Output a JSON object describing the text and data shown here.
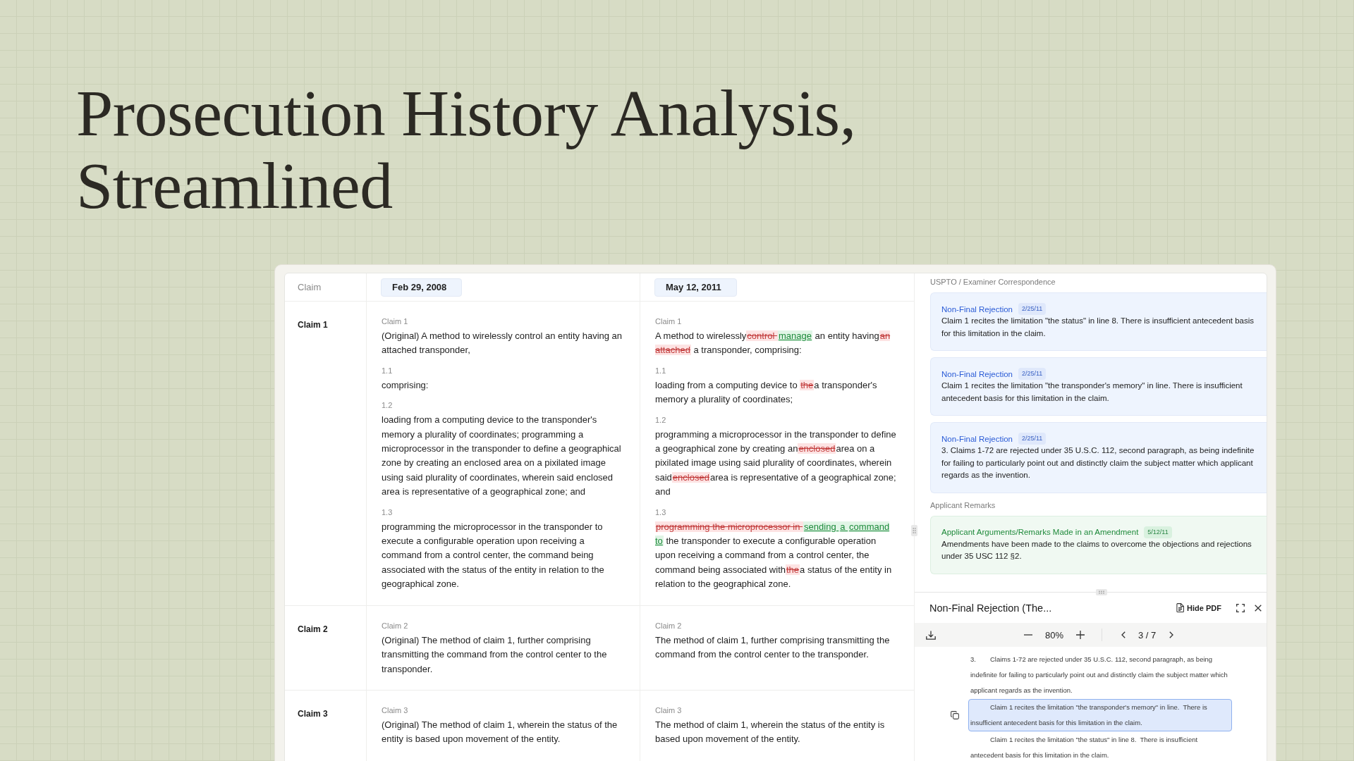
{
  "title": "Prosecution History Analysis, Streamlined",
  "comparison": {
    "header": {
      "label": "Claim",
      "versions": [
        "Feb 29, 2008",
        "May 12, 2011"
      ]
    },
    "claims": [
      {
        "name": "Claim 1",
        "versions": [
          {
            "sections": [
              {
                "label": "Claim 1",
                "segments": [
                  {
                    "kind": "text",
                    "text": "(Original) A method to wirelessly control an entity having an attached transponder,"
                  }
                ]
              },
              {
                "label": "1.1",
                "segments": [
                  {
                    "kind": "text",
                    "text": "comprising:"
                  }
                ]
              },
              {
                "label": "1.2",
                "segments": [
                  {
                    "kind": "text",
                    "text": "loading from a computing device to the transponder's memory a plurality of coordinates; programming a microprocessor in the transponder to define a geographical zone by creating an enclosed area on a pixilated image using said plurality of coordinates, wherein said enclosed area is representative of a geographical zone; and"
                  }
                ]
              },
              {
                "label": "1.3",
                "segments": [
                  {
                    "kind": "text",
                    "text": "programming the microprocessor in the transponder to execute a configurable operation upon receiving a command from a control center, the command being associated with the status of the entity in relation to the geographical zone."
                  }
                ]
              }
            ]
          },
          {
            "sections": [
              {
                "label": "Claim 1",
                "segments": [
                  {
                    "kind": "text",
                    "text": "A method to wirelessly"
                  },
                  {
                    "kind": "deleted",
                    "text": "control "
                  },
                  {
                    "kind": "inserted",
                    "text": "manage"
                  },
                  {
                    "kind": "text",
                    "text": " an entity having"
                  },
                  {
                    "kind": "deleted",
                    "text": "an attached"
                  },
                  {
                    "kind": "text",
                    "text": " a transponder, comprising:"
                  }
                ]
              },
              {
                "label": "1.1",
                "segments": [
                  {
                    "kind": "text",
                    "text": "loading from a computing device to "
                  },
                  {
                    "kind": "deleted",
                    "text": "the"
                  },
                  {
                    "kind": "text",
                    "text": "a transponder's memory a plurality of coordinates;"
                  }
                ]
              },
              {
                "label": "1.2",
                "segments": [
                  {
                    "kind": "text",
                    "text": "programming a microprocessor in the transponder to define a geographical zone by creating an"
                  },
                  {
                    "kind": "deleted",
                    "text": "enclosed"
                  },
                  {
                    "kind": "text",
                    "text": "area on a pixilated image using said plurality of coordinates, wherein said"
                  },
                  {
                    "kind": "deleted",
                    "text": "enclosed"
                  },
                  {
                    "kind": "text",
                    "text": "area is representative of a geographical zone; and"
                  }
                ]
              },
              {
                "label": "1.3",
                "segments": [
                  {
                    "kind": "deleted",
                    "text": "programming the microprocessor in "
                  },
                  {
                    "kind": "inserted",
                    "text": "sending "
                  },
                  {
                    "kind": "inserted",
                    "text": "a "
                  },
                  {
                    "kind": "inserted",
                    "text": "command to"
                  },
                  {
                    "kind": "text",
                    "text": " the transponder to execute a configurable operation upon receiving a command from a control center, the command being associated with"
                  },
                  {
                    "kind": "deleted",
                    "text": "the"
                  },
                  {
                    "kind": "text",
                    "text": "a status of the entity in relation to the geographical zone."
                  }
                ]
              }
            ]
          }
        ]
      },
      {
        "name": "Claim 2",
        "versions": [
          {
            "sections": [
              {
                "label": "Claim 2",
                "segments": [
                  {
                    "kind": "text",
                    "text": "(Original) The method of claim 1, further comprising transmitting the command from the control center to the transponder."
                  }
                ]
              }
            ]
          },
          {
            "sections": [
              {
                "label": "Claim 2",
                "segments": [
                  {
                    "kind": "text",
                    "text": "The method of claim 1, further comprising transmitting the command from the control center to the transponder."
                  }
                ]
              }
            ]
          }
        ]
      },
      {
        "name": "Claim 3",
        "versions": [
          {
            "sections": [
              {
                "label": "Claim 3",
                "segments": [
                  {
                    "kind": "text",
                    "text": "(Original) The method of claim 1, wherein the status of the entity is based upon movement of the entity."
                  }
                ]
              }
            ]
          },
          {
            "sections": [
              {
                "label": "Claim 3",
                "segments": [
                  {
                    "kind": "text",
                    "text": "The method of claim 1, wherein the status of the entity is based upon movement of the entity."
                  }
                ]
              }
            ]
          }
        ]
      }
    ]
  },
  "correspondence": {
    "groups": [
      {
        "heading": "USPTO / Examiner Correspondence",
        "entries": [
          {
            "kind": "rejection",
            "title": "Non-Final Rejection",
            "date": "2/25/11",
            "text": "Claim 1 recites the limitation \"the status\" in line 8. There is insufficient antecedent basis for this limitation in the claim."
          },
          {
            "kind": "rejection",
            "title": "Non-Final Rejection",
            "date": "2/25/11",
            "text": "Claim 1 recites the limitation \"the transponder's memory\" in line. There is insufficient antecedent basis for this limitation in the claim."
          },
          {
            "kind": "rejection",
            "title": "Non-Final Rejection",
            "date": "2/25/11",
            "text": "3. Claims 1-72 are rejected under 35 U.S.C. 112, second paragraph, as being indefinite for failing to particularly point out and distinctly claim the subject matter which applicant regards as the invention."
          }
        ]
      },
      {
        "heading": "Applicant Remarks",
        "entries": [
          {
            "kind": "remark",
            "title": "Applicant Arguments/Remarks Made in an Amendment",
            "date": "5/12/11",
            "text": "Amendments have been made to the claims to overcome the objections and rejections under 35 USC 112 §2."
          }
        ]
      }
    ]
  },
  "pdf_viewer": {
    "title": "Non-Final Rejection (The...",
    "hide_button": "Hide PDF",
    "zoom": "80%",
    "page": "3 / 7",
    "paragraphs": [
      {
        "number": "3.",
        "text": "Claims 1-72 are rejected under 35 U.S.C. 112, second paragraph, as being indefinite for failing to particularly point out and distinctly claim the subject matter which applicant regards as the invention.",
        "selected": false
      },
      {
        "text": "Claim 1 recites the limitation \"the transponder's memory\" in line.  There is insufficient antecedent basis for this limitation in the claim.",
        "selected": true
      },
      {
        "text": "Claim 1 recites the limitation \"the status\" in line 8.  There is insufficient antecedent basis for this limitation in the claim.",
        "selected": false
      }
    ]
  }
}
